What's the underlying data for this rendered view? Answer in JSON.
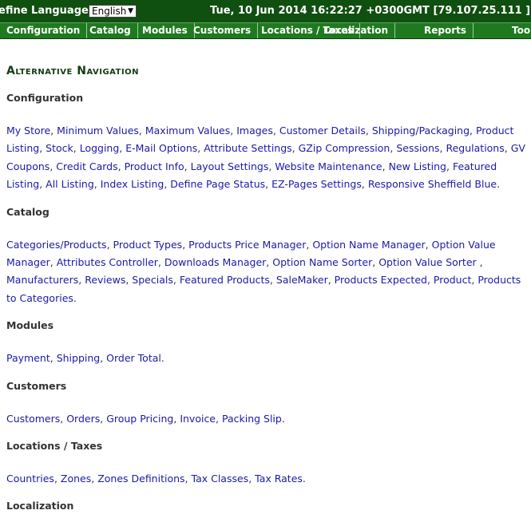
{
  "header": {
    "language_label": "efine Language:",
    "language_selected": "English",
    "datetime": "Tue, 10 Jun 2014 16:22:27 +0300GMT [79.107.25.111 ]"
  },
  "nav": [
    "Configuration",
    "Catalog",
    "Modules",
    "Customers",
    "Locations / Taxes",
    "Localization",
    "Reports",
    "Tools"
  ],
  "page_title": "Alternative Navigation",
  "sections": [
    {
      "heading": "Configuration",
      "links": [
        "My Store",
        "Minimum Values",
        "Maximum Values",
        "Images",
        "Customer Details",
        "Shipping/Packaging",
        "Product Listing",
        "Stock",
        "Logging",
        "E-Mail Options",
        "Attribute Settings",
        "GZip Compression",
        "Sessions",
        "Regulations",
        "GV Coupons",
        "Credit Cards",
        "Product Info",
        "Layout Settings",
        "Website Maintenance",
        "New Listing",
        "Featured Listing",
        "All Listing",
        "Index Listing",
        "Define Page Status",
        "EZ-Pages Settings",
        "Responsive Sheffield Blue"
      ]
    },
    {
      "heading": "Catalog",
      "links": [
        "Categories/Products",
        "Product Types",
        "Products Price Manager",
        "Option Name Manager",
        "Option Value Manager",
        "Attributes Controller",
        "Downloads Manager",
        "Option Name Sorter",
        "Option Value Sorter ",
        "Manufacturers",
        "Reviews",
        "Specials",
        "Featured Products",
        "SaleMaker",
        "Products Expected",
        "Product",
        "Products to Categories"
      ]
    },
    {
      "heading": "Modules",
      "links": [
        "Payment",
        "Shipping",
        "Order Total"
      ]
    },
    {
      "heading": "Customers",
      "links": [
        "Customers",
        "Orders",
        "Group Pricing",
        "Invoice",
        "Packing Slip"
      ]
    },
    {
      "heading": "Locations / Taxes",
      "links": [
        "Countries",
        "Zones",
        "Zones Definitions",
        "Tax Classes",
        "Tax Rates"
      ]
    },
    {
      "heading": "Localization",
      "links": []
    }
  ]
}
